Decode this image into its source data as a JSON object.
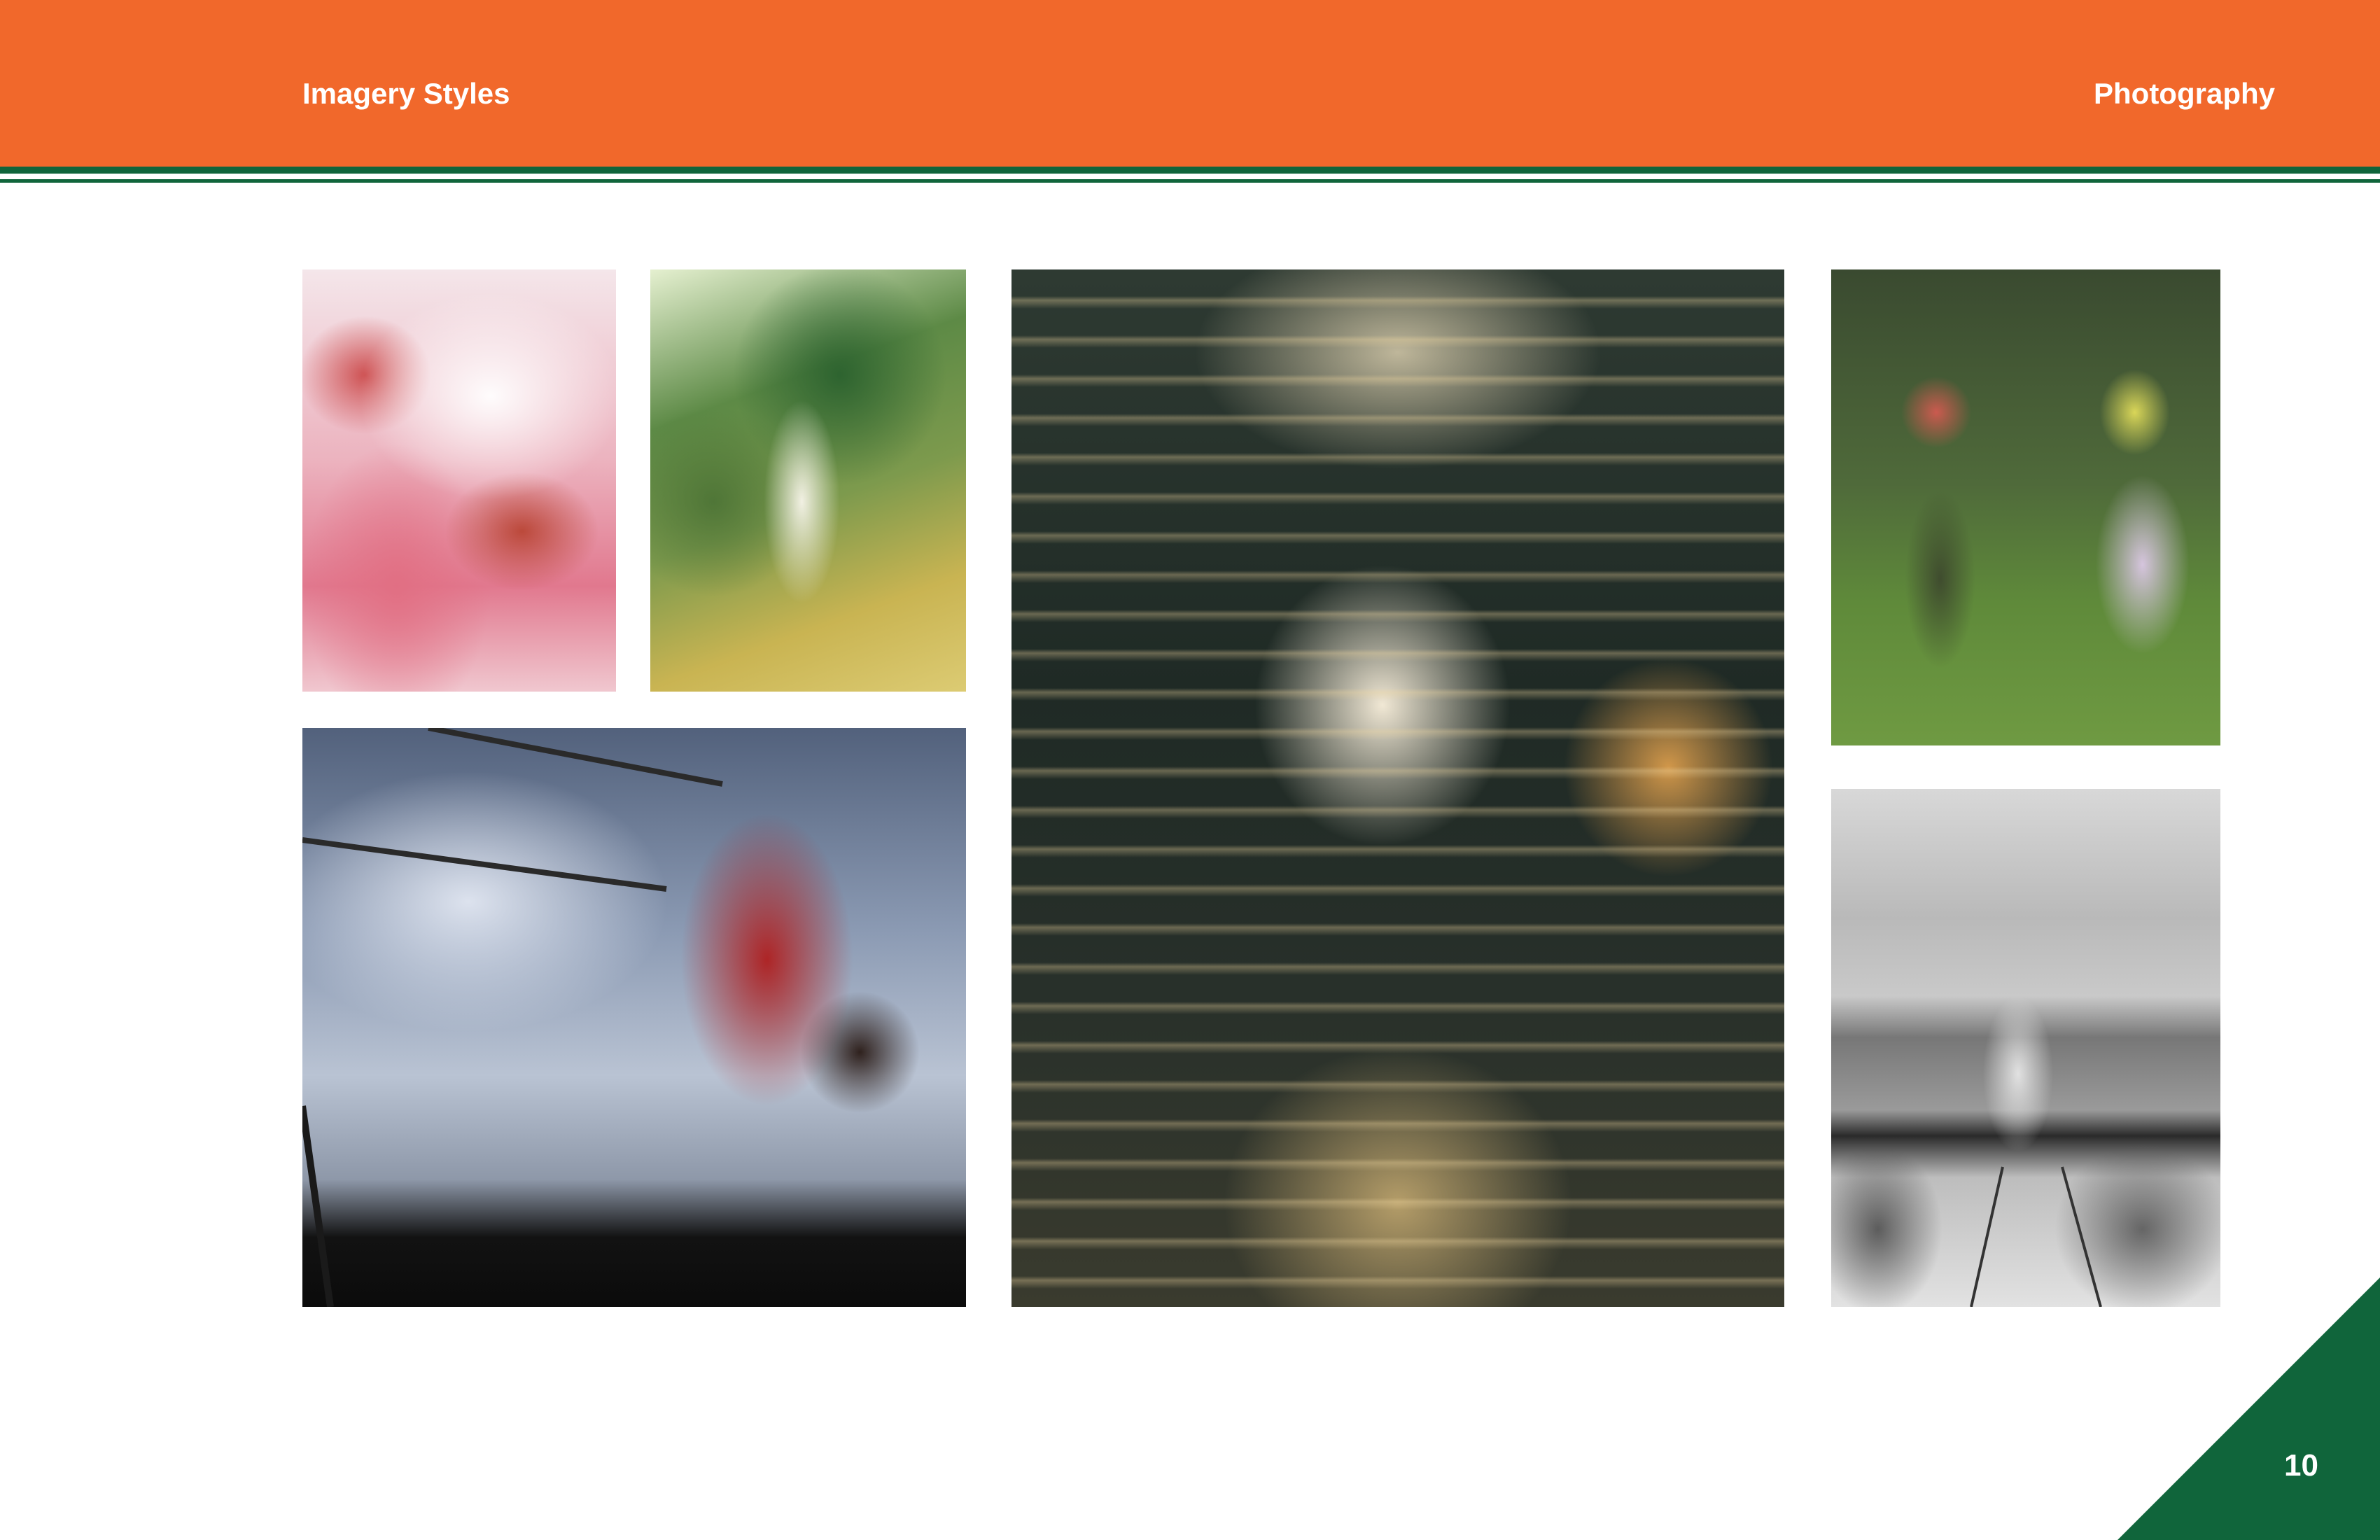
{
  "header": {
    "title": "Imagery Styles",
    "section": "Photography"
  },
  "colors": {
    "header_background": "#f1682b",
    "accent_green": "#10653b",
    "header_text": "#ffffff"
  },
  "photos": [
    {
      "description": "lily-closeup"
    },
    {
      "description": "blurred-garden"
    },
    {
      "description": "girl-on-swing"
    },
    {
      "description": "blurred-runners"
    },
    {
      "description": "women-dancing"
    },
    {
      "description": "upside-down-swing-bw"
    }
  ],
  "footer": {
    "page_number": "10"
  }
}
